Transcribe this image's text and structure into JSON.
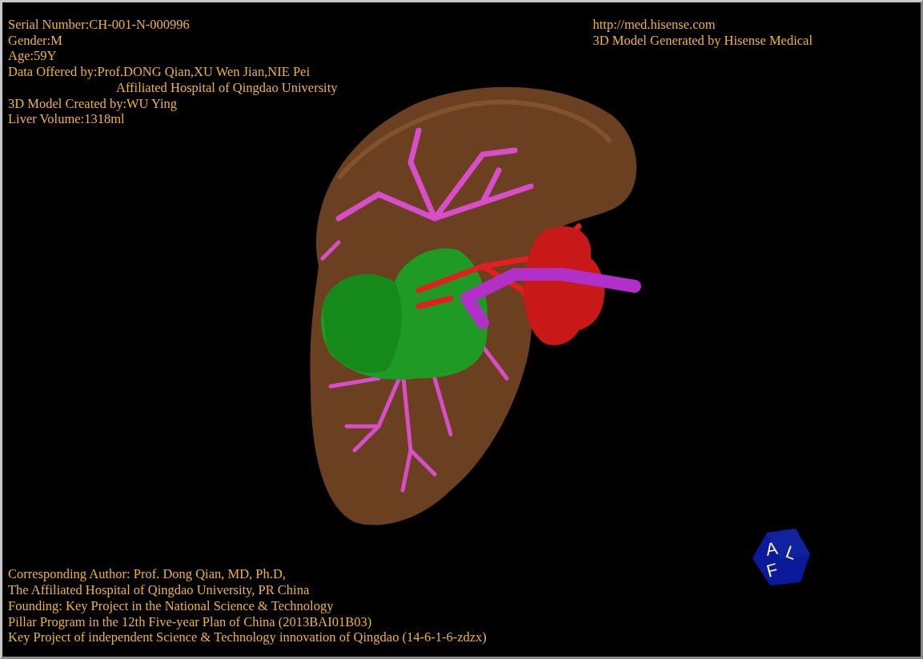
{
  "patient_info": [
    {
      "text": "Serial Number:CH-001-N-000996",
      "kind": "field"
    },
    {
      "text": "Gender:M",
      "kind": "field"
    },
    {
      "text": "Age:59Y",
      "kind": "field"
    },
    {
      "text": "Data Offered by:Prof.DONG Qian,XU Wen Jian,NIE Pei",
      "kind": "field"
    },
    {
      "text": "Affiliated Hospital of Qingdao University",
      "kind": "continuation"
    },
    {
      "text": "3D Model Created by:WU Ying",
      "kind": "field"
    },
    {
      "text": "Liver Volume:1318ml",
      "kind": "field"
    }
  ],
  "vendor_info": [
    "http://med.hisense.com",
    "3D Model Generated by Hisense Medical"
  ],
  "orientation_cube": {
    "labels": [
      "A",
      "L",
      "F"
    ]
  },
  "credits": [
    "Corresponding Author: Prof. Dong Qian, MD, Ph.D,",
    "The Affiliated Hospital of Qingdao University, PR China",
    "Founding: Key Project in the National Science & Technology",
    "Pillar Program in the 12th Five-year Plan of China (2013BAI01B03)",
    "Key Project of independent Science & Technology innovation of Qingdao (14-6-1-6-zdzx)"
  ]
}
